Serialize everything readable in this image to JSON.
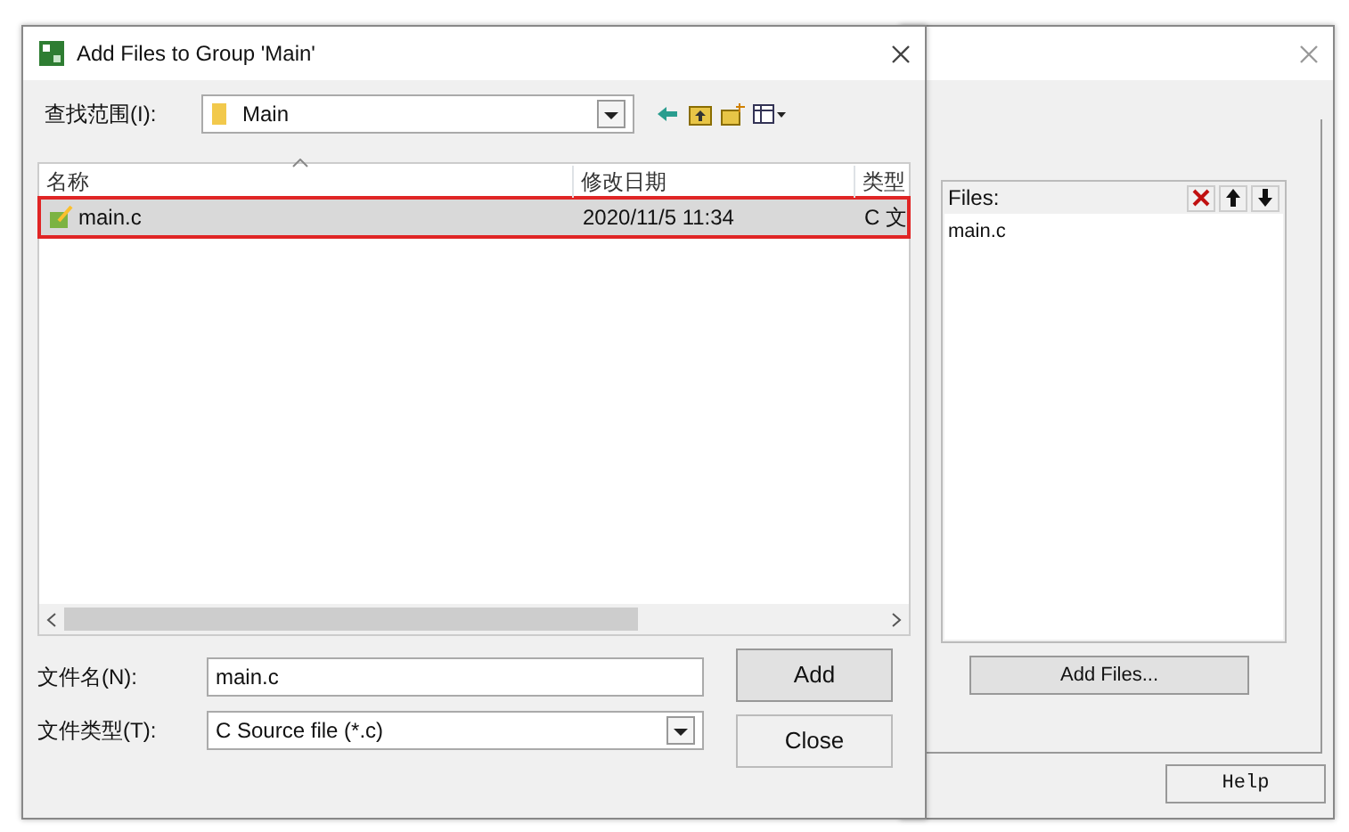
{
  "dialog": {
    "title": "Add Files to Group 'Main'",
    "look_in": {
      "label": "查找范围(I):",
      "value": "Main"
    },
    "file_list": {
      "columns": [
        "名称",
        "修改日期",
        "类型"
      ],
      "rows": [
        {
          "name": "main.c",
          "modified": "2020/11/5 11:34",
          "type": "C 文",
          "selected": true
        }
      ]
    },
    "file_name": {
      "label": "文件名(N):",
      "value": "main.c"
    },
    "file_type": {
      "label": "文件类型(T):",
      "value": "C Source file (*.c)"
    },
    "buttons": [
      "Add",
      "Close"
    ]
  },
  "back_window": {
    "files_panel": {
      "label": "Files:",
      "items": [
        "main.c"
      ]
    },
    "add_button": "Add Files...",
    "help_button": "Help"
  }
}
